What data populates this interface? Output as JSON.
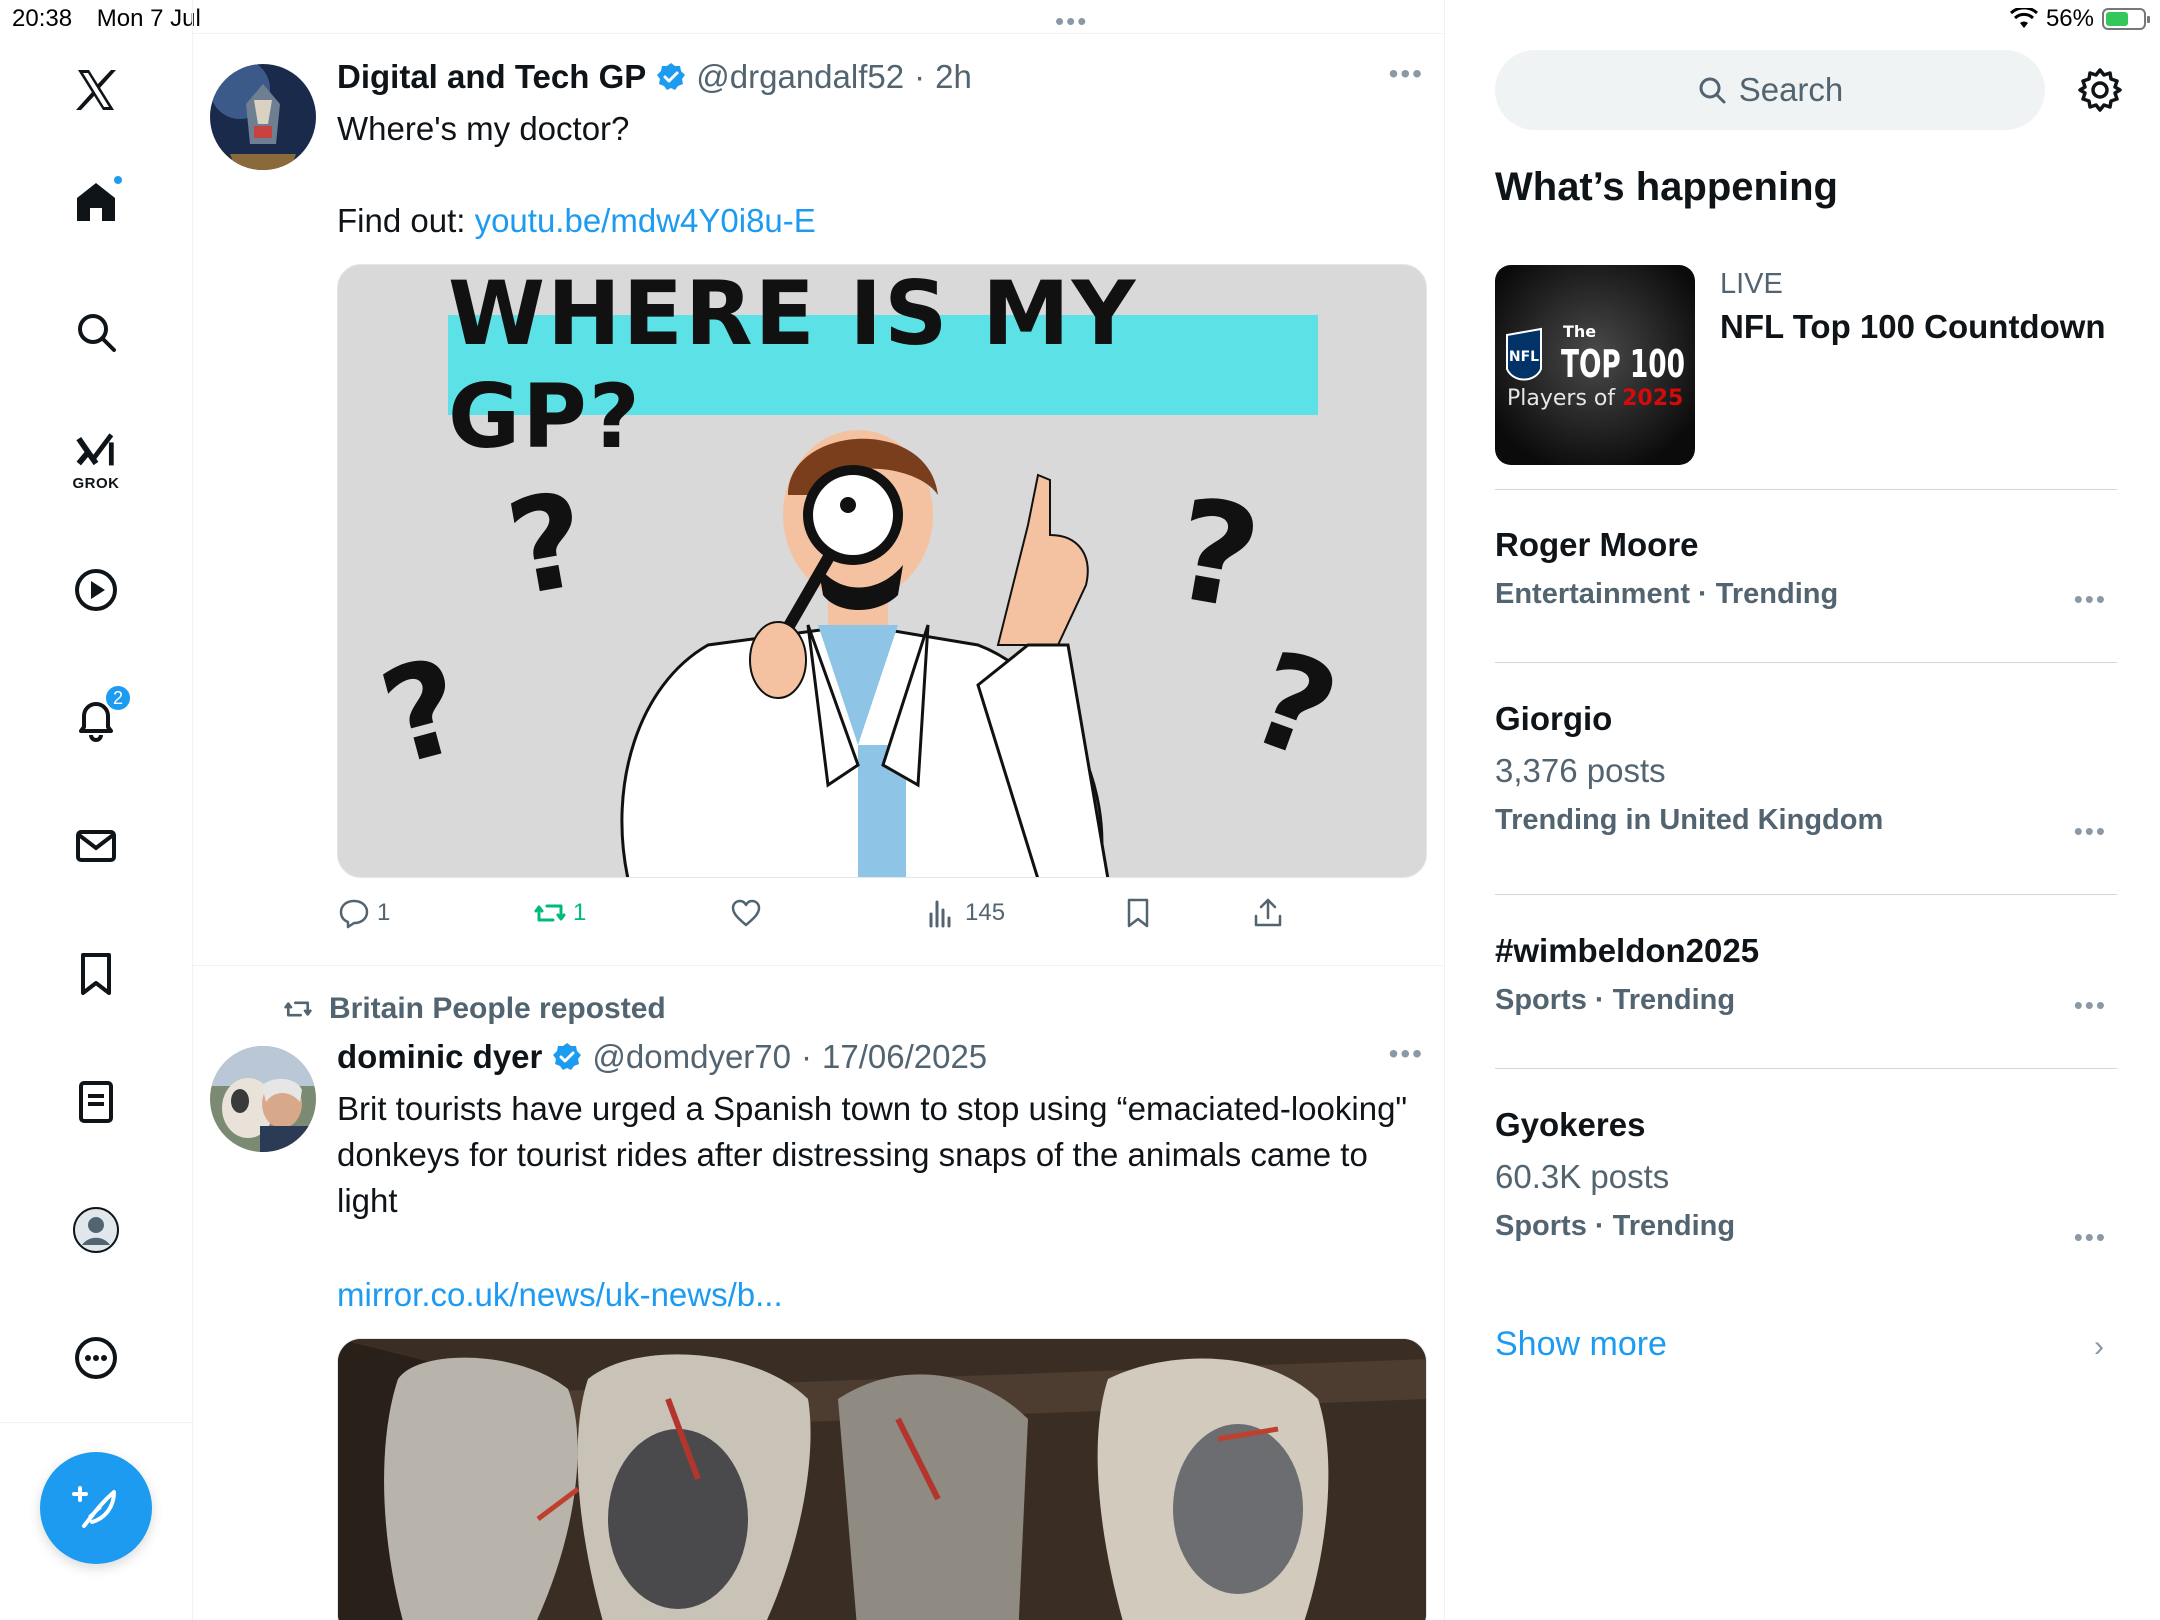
{
  "status": {
    "time": "20:38",
    "date": "Mon 7 Jul",
    "battery": "56%"
  },
  "sidebar": {
    "grok_label": "GROK",
    "notifications_count": "2"
  },
  "tweets": [
    {
      "name": "Digital and Tech GP",
      "handle": "@drgandalf52",
      "time": "2h",
      "text_line1": "Where's my doctor?",
      "text_line2": "Find out: ",
      "link": "youtu.be/mdw4Y0i8u-E",
      "media_title": "WHERE IS MY GP?",
      "replies": "1",
      "reposts": "1",
      "views": "145"
    },
    {
      "repost_by": "Britain People reposted",
      "name": "dominic dyer",
      "handle": "@domdyer70",
      "time": "17/06/2025",
      "text": "Brit tourists have urged a Spanish town to stop using “emaciated-looking\" donkeys for tourist rides after distressing snaps of the animals came to light",
      "link": "mirror.co.uk/news/uk-news/b..."
    }
  ],
  "right": {
    "search_placeholder": "Search",
    "whats_happening": "What’s happening",
    "live": {
      "label": "LIVE",
      "title": "NFL Top 100 Countdown",
      "thumb_top": "The",
      "thumb_main": "TOP 100",
      "thumb_sub_a": "Players of ",
      "thumb_sub_b": "2025",
      "thumb_logo": "NFL"
    },
    "trends": [
      {
        "title": "Roger Moore",
        "posts": "",
        "meta": "Entertainment · Trending"
      },
      {
        "title": "Giorgio",
        "posts": "3,376 posts",
        "meta": "Trending in United Kingdom"
      },
      {
        "title": "#wimbeldon2025",
        "posts": "",
        "meta": "Sports · Trending"
      },
      {
        "title": "Gyokeres",
        "posts": "60.3K posts",
        "meta": "Sports · Trending"
      }
    ],
    "show_more": "Show more"
  },
  "colors": {
    "accent": "#1d9bf0",
    "repost_green": "#00ba7c",
    "media_bg": "#d9d9d9",
    "title_highlight": "#5ce1e6"
  }
}
